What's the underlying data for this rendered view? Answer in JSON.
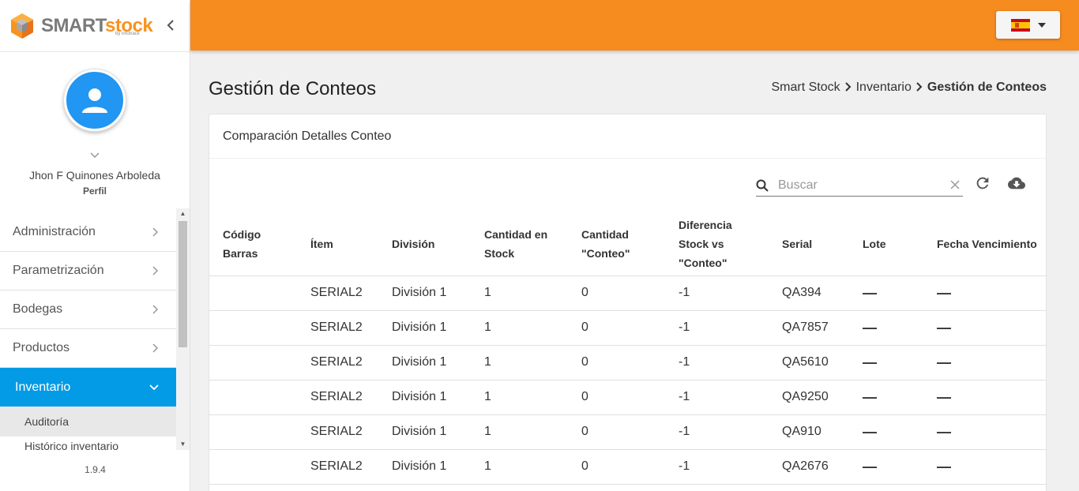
{
  "brand": {
    "name_part1": "SMART",
    "name_part2": "stock",
    "sub": "by infotrack"
  },
  "profile": {
    "name": "Jhon F Quinones Arboleda",
    "role": "Perfil"
  },
  "menu": {
    "items": [
      {
        "label": "Administración"
      },
      {
        "label": "Parametrización"
      },
      {
        "label": "Bodegas"
      },
      {
        "label": "Productos"
      }
    ],
    "active": {
      "label": "Inventario"
    },
    "subitems": [
      {
        "label": "Auditoría"
      },
      {
        "label": "Histórico inventario"
      }
    ]
  },
  "version": "1.9.4",
  "page": {
    "title": "Gestión de Conteos",
    "breadcrumb": [
      "Smart Stock",
      "Inventario",
      "Gestión de Conteos"
    ]
  },
  "card": {
    "title": "Comparación Detalles Conteo",
    "search_placeholder": "Buscar"
  },
  "table": {
    "headers": [
      "Código Barras",
      "Ítem",
      "División",
      "Cantidad en Stock",
      "Cantidad \"Conteo\"",
      "Diferencia Stock vs \"Conteo\"",
      "Serial",
      "Lote",
      "Fecha Vencimiento"
    ],
    "rows": [
      [
        "",
        "SERIAL2",
        "División 1",
        "1",
        "0",
        "-1",
        "QA394",
        "—",
        "—"
      ],
      [
        "",
        "SERIAL2",
        "División 1",
        "1",
        "0",
        "-1",
        "QA7857",
        "—",
        "—"
      ],
      [
        "",
        "SERIAL2",
        "División 1",
        "1",
        "0",
        "-1",
        "QA5610",
        "—",
        "—"
      ],
      [
        "",
        "SERIAL2",
        "División 1",
        "1",
        "0",
        "-1",
        "QA9250",
        "—",
        "—"
      ],
      [
        "",
        "SERIAL2",
        "División 1",
        "1",
        "0",
        "-1",
        "QA910",
        "—",
        "—"
      ],
      [
        "",
        "SERIAL2",
        "División 1",
        "1",
        "0",
        "-1",
        "QA2676",
        "—",
        "—"
      ]
    ]
  },
  "colors": {
    "topbar": "#f68b1f",
    "active_menu": "#039be5",
    "avatar": "#2196f3"
  }
}
